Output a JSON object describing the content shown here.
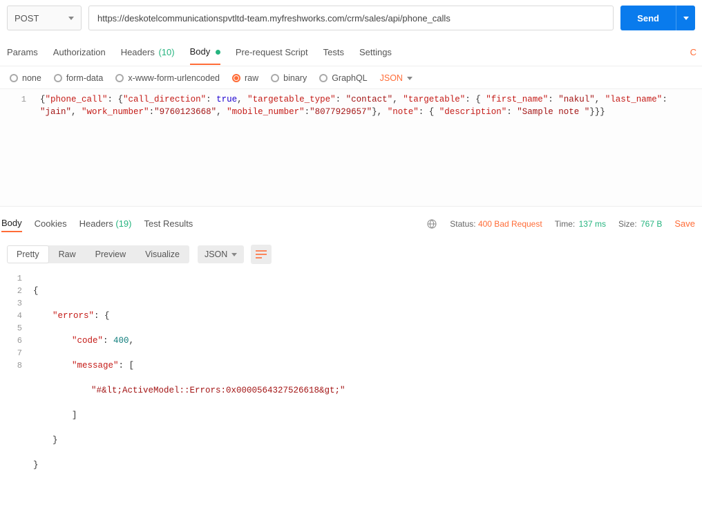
{
  "request": {
    "method": "POST",
    "url": "https://deskotelcommunicationspvtltd-team.myfreshworks.com/crm/sales/api/phone_calls",
    "send_label": "Send"
  },
  "tabs": {
    "params": "Params",
    "authorization": "Authorization",
    "headers": "Headers",
    "headers_count": "(10)",
    "body": "Body",
    "prerequest": "Pre-request Script",
    "tests": "Tests",
    "settings": "Settings",
    "right_cut": "C"
  },
  "body_types": {
    "none": "none",
    "form_data": "form-data",
    "xwww": "x-www-form-urlencoded",
    "raw": "raw",
    "binary": "binary",
    "graphql": "GraphQL",
    "content_type": "JSON"
  },
  "request_body_tokens": [
    [
      {
        "t": "{",
        "c": "punct"
      },
      {
        "t": "\"phone_call\"",
        "c": "red"
      },
      {
        "t": ": {",
        "c": "punct"
      },
      {
        "t": "\"call_direction\"",
        "c": "red"
      },
      {
        "t": ": ",
        "c": "punct"
      },
      {
        "t": "true",
        "c": "blue"
      },
      {
        "t": ", ",
        "c": "punct"
      },
      {
        "t": "\"targetable_type\"",
        "c": "red"
      },
      {
        "t": ": ",
        "c": "punct"
      },
      {
        "t": "\"contact\"",
        "c": "brown"
      },
      {
        "t": ", ",
        "c": "punct"
      },
      {
        "t": "\"targetable\"",
        "c": "red"
      },
      {
        "t": ": { ",
        "c": "punct"
      },
      {
        "t": "\"first_name\"",
        "c": "red"
      },
      {
        "t": ": ",
        "c": "punct"
      },
      {
        "t": "\"nakul\"",
        "c": "brown"
      },
      {
        "t": ", ",
        "c": "punct"
      },
      {
        "t": "\"last_name\"",
        "c": "red"
      },
      {
        "t": ": ",
        "c": "punct"
      },
      {
        "t": "\"jain\"",
        "c": "brown"
      },
      {
        "t": ", ",
        "c": "punct"
      },
      {
        "t": "\"work_number\"",
        "c": "red"
      },
      {
        "t": ":",
        "c": "punct"
      },
      {
        "t": "\"9760123668\"",
        "c": "brown"
      },
      {
        "t": ", ",
        "c": "punct"
      },
      {
        "t": "\"mobile_number\"",
        "c": "red"
      },
      {
        "t": ":",
        "c": "punct"
      },
      {
        "t": "\"8077929657\"",
        "c": "brown"
      },
      {
        "t": "}, ",
        "c": "punct"
      },
      {
        "t": "\"note\"",
        "c": "red"
      },
      {
        "t": ": { ",
        "c": "punct"
      },
      {
        "t": "\"description\"",
        "c": "red"
      },
      {
        "t": ": ",
        "c": "punct"
      },
      {
        "t": "\"Sample note \"",
        "c": "brown"
      },
      {
        "t": "}}}",
        "c": "punct"
      }
    ]
  ],
  "response_tabs": {
    "body": "Body",
    "cookies": "Cookies",
    "headers": "Headers",
    "headers_count": "(19)",
    "test_results": "Test Results"
  },
  "response_meta": {
    "status_label": "Status:",
    "status_value": "400 Bad Request",
    "time_label": "Time:",
    "time_value": "137 ms",
    "size_label": "Size:",
    "size_value": "767 B",
    "save": "Save"
  },
  "view_modes": {
    "pretty": "Pretty",
    "raw": "Raw",
    "preview": "Preview",
    "visualize": "Visualize",
    "type": "JSON"
  },
  "response_body": {
    "line1": "{",
    "line2_key": "\"errors\"",
    "line2_rest": ": {",
    "line3_key": "\"code\"",
    "line3_colon": ": ",
    "line3_val": "400",
    "line3_comma": ",",
    "line4_key": "\"message\"",
    "line4_rest": ": [",
    "line5_val": "\"#&lt;ActiveModel::Errors:0x0000564327526618&gt;\"",
    "line6": "]",
    "line7": "}",
    "line8": "}"
  }
}
